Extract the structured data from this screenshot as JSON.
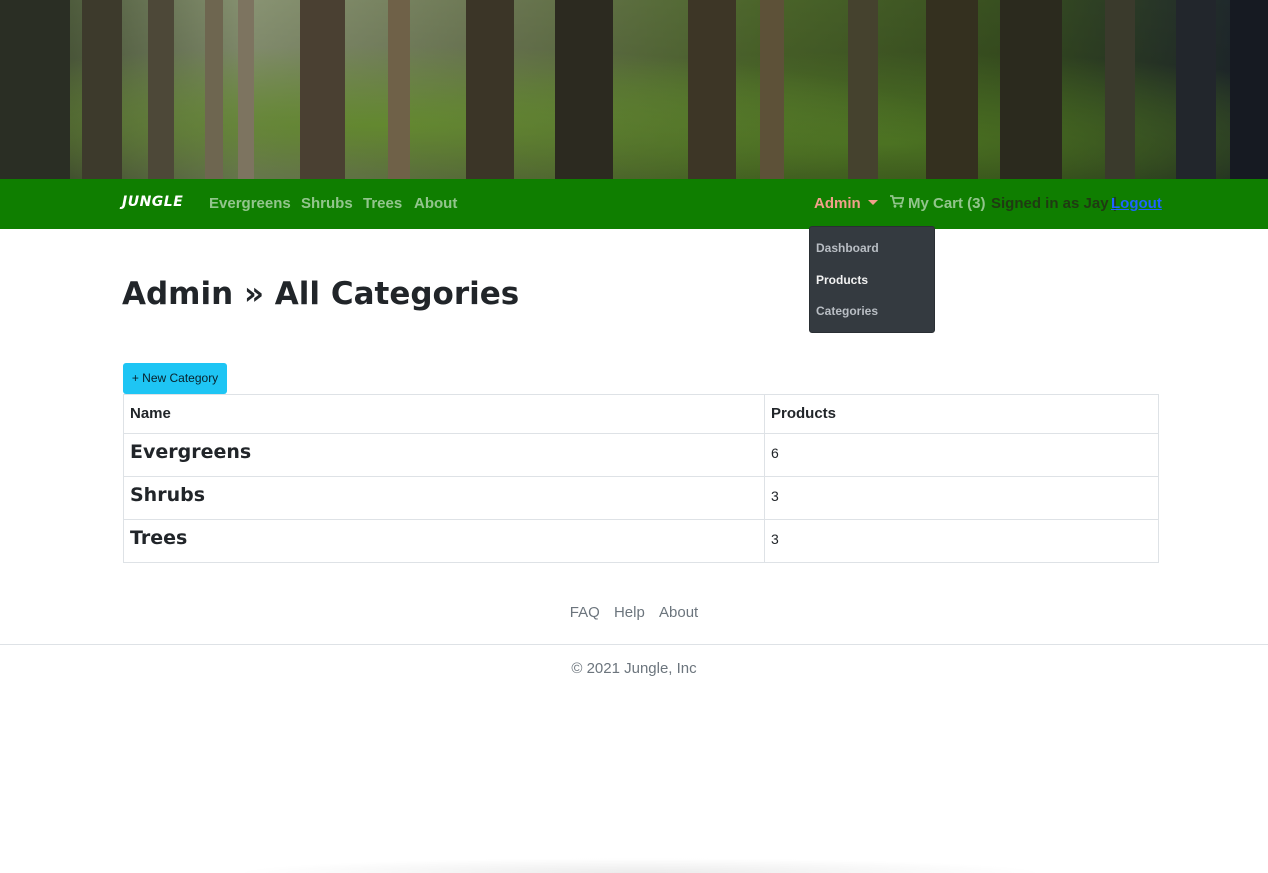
{
  "navbar": {
    "brand": "JUNGLE",
    "links": [
      "Evergreens",
      "Shrubs",
      "Trees",
      "About"
    ],
    "admin_label": "Admin",
    "cart_label": "My Cart (3)",
    "signed_in_text": "Signed in as Jay |",
    "logout_label": "Logout"
  },
  "dropdown": {
    "items": [
      "Dashboard",
      "Products",
      "Categories"
    ]
  },
  "page": {
    "title": "Admin » All Categories",
    "new_button_label": "+ New Category"
  },
  "table": {
    "headers": [
      "Name",
      "Products"
    ],
    "rows": [
      {
        "name": "Evergreens",
        "products": "6"
      },
      {
        "name": "Shrubs",
        "products": "3"
      },
      {
        "name": "Trees",
        "products": "3"
      }
    ]
  },
  "footer": {
    "links": [
      "FAQ",
      "Help",
      "About"
    ],
    "copyright": "© 2021 Jungle, Inc"
  },
  "colors": {
    "navbar": "#0f7e00",
    "admin_accent": "#f0a08a",
    "button": "#1ec5f4",
    "dropdown_bg": "#343a40",
    "logout_link": "#1e63ff"
  },
  "icons": {
    "cart": "shopping-cart-icon",
    "caret": "caret-down-icon",
    "banner": "forest-banner-image"
  }
}
